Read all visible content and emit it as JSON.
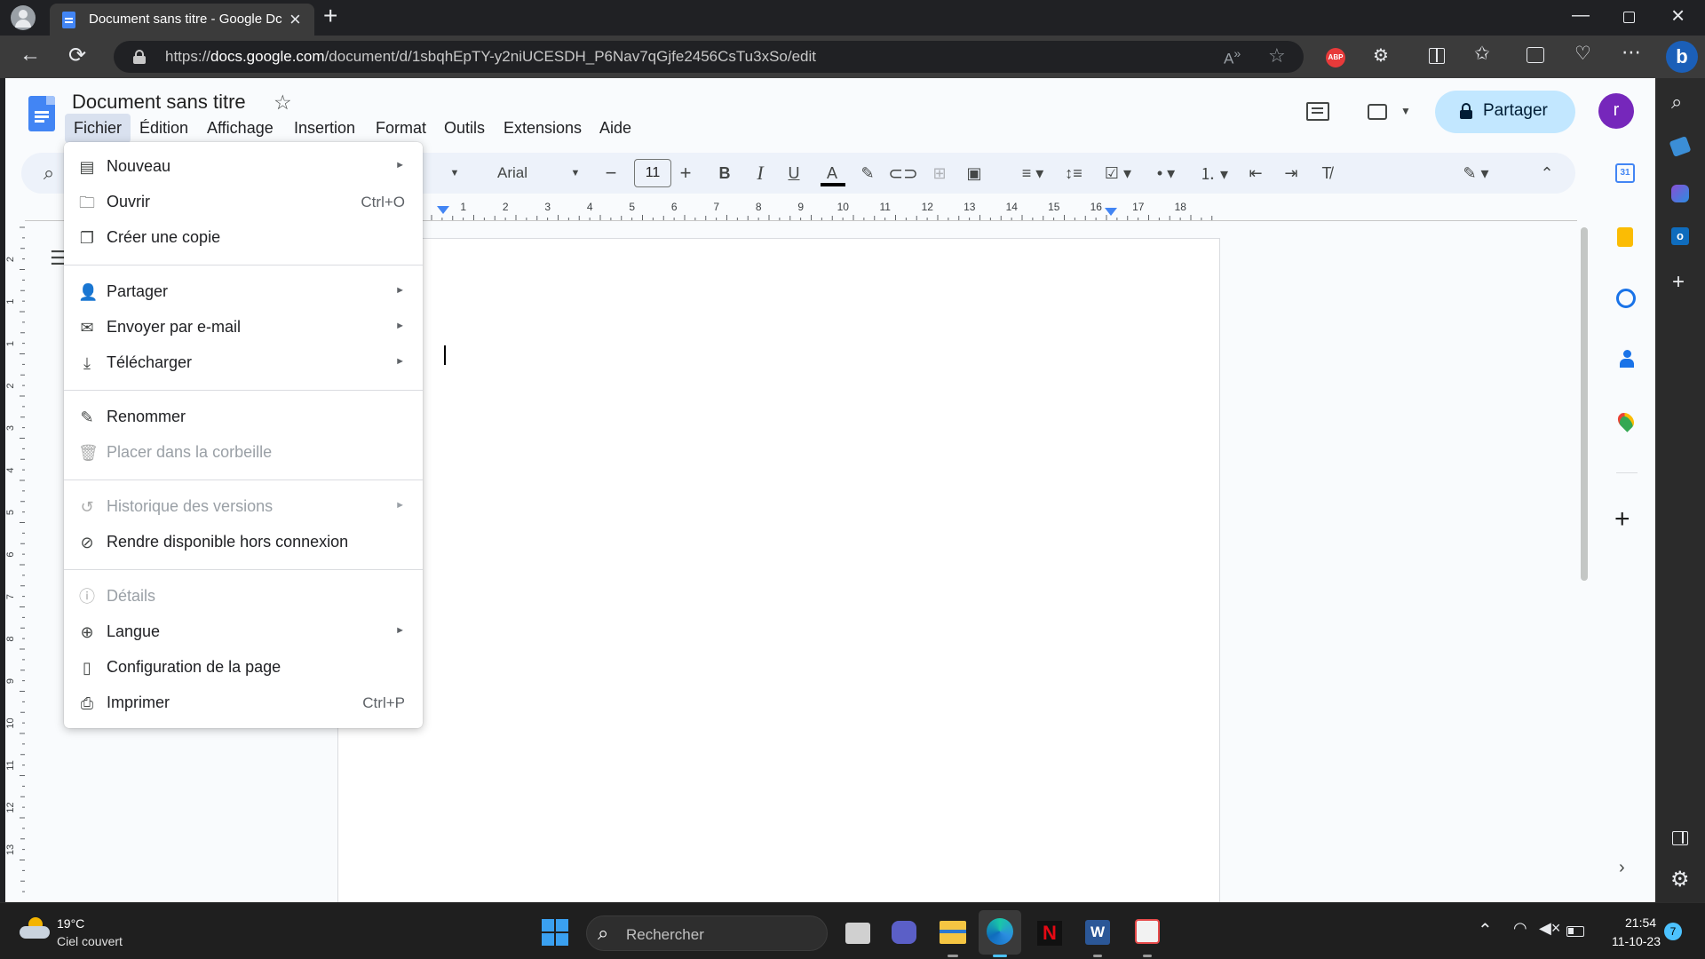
{
  "browser": {
    "tab_title": "Document sans titre - Google Dc",
    "url_domain": "docs.google.com",
    "url_prefix": "https://",
    "url_path": "/document/d/1sbqhEpTY-y2niUCESDH_P6Nav7qGjfe2456CsTu3xSo/edit",
    "extension_abp": "ABP"
  },
  "docs": {
    "doc_title": "Document sans titre",
    "share_label": "Partager",
    "avatar_letter": "r",
    "menubar": [
      "Fichier",
      "Édition",
      "Affichage",
      "Insertion",
      "Format",
      "Outils",
      "Extensions",
      "Aide"
    ],
    "toolbar": {
      "font": "Arial",
      "font_size": "11"
    },
    "ruler_numbers": [
      "1",
      "2",
      "3",
      "4",
      "5",
      "6",
      "7",
      "8",
      "9",
      "10",
      "11",
      "12",
      "13",
      "14",
      "15",
      "16",
      "17",
      "18"
    ],
    "vruler_numbers": [
      "2",
      "1",
      "1",
      "2",
      "3",
      "4",
      "5",
      "6",
      "7",
      "8",
      "9",
      "10",
      "11",
      "12",
      "13"
    ]
  },
  "file_menu": {
    "items": [
      {
        "label": "Nouveau",
        "icon": "doc-icon",
        "submenu": true
      },
      {
        "label": "Ouvrir",
        "icon": "folder-icon",
        "shortcut": "Ctrl+O"
      },
      {
        "label": "Créer une copie",
        "icon": "copy-icon"
      },
      {
        "label": "Partager",
        "icon": "person-add-icon",
        "submenu": true
      },
      {
        "label": "Envoyer par e-mail",
        "icon": "mail-icon",
        "submenu": true
      },
      {
        "label": "Télécharger",
        "icon": "download-icon",
        "submenu": true
      },
      {
        "label": "Renommer",
        "icon": "rename-icon"
      },
      {
        "label": "Placer dans la corbeille",
        "icon": "trash-icon",
        "disabled": true
      },
      {
        "label": "Historique des versions",
        "icon": "history-icon",
        "submenu": true,
        "disabled": true
      },
      {
        "label": "Rendre disponible hors connexion",
        "icon": "offline-icon"
      },
      {
        "label": "Détails",
        "icon": "info-icon",
        "disabled": true
      },
      {
        "label": "Langue",
        "icon": "globe-icon",
        "submenu": true
      },
      {
        "label": "Configuration de la page",
        "icon": "page-setup-icon"
      },
      {
        "label": "Imprimer",
        "icon": "printer-icon",
        "shortcut": "Ctrl+P"
      }
    ]
  },
  "taskbar": {
    "weather_temp": "19°C",
    "weather_desc": "Ciel couvert",
    "search_label": "Rechercher",
    "time": "21:54",
    "date": "11-10-23",
    "notification_count": "7"
  },
  "colors": {
    "docs_blue": "#4285f4",
    "share_bg": "#c2e7ff",
    "avatar_bg": "#7627bb",
    "abp_red": "#e73a3a"
  }
}
